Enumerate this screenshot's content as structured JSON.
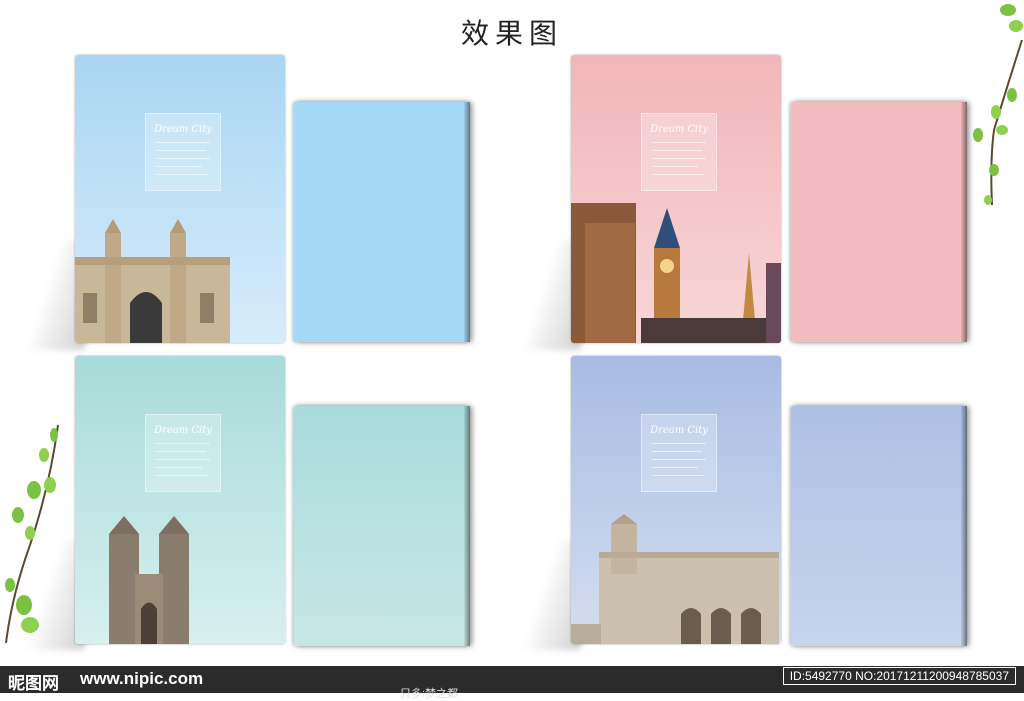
{
  "page": {
    "title": "效果图"
  },
  "cover_text": {
    "script": "Dream City"
  },
  "books": [
    {
      "id": "gateway",
      "front_color_top": "#b6dcf4",
      "front_color_bottom": "#d9eefb",
      "back_color": "#a8daf7"
    },
    {
      "id": "big-ben",
      "front_color_top": "#f2b9bd",
      "front_color_bottom": "#f7d2d4",
      "back_color": "#f3bcc0"
    },
    {
      "id": "westminster",
      "front_color_top": "#a9dcdb",
      "front_color_bottom": "#d5eeee",
      "back_color": "#afdedd"
    },
    {
      "id": "plaza",
      "front_color_top": "#a9bde4",
      "front_color_bottom": "#d2dcef",
      "back_color": "#b0c3e6"
    }
  ],
  "footer": {
    "logo": "昵图网",
    "url": "www.nipic.com",
    "id_text": "ID:5492770 NO:20171211200948785037",
    "author": "只多:梦之都"
  }
}
